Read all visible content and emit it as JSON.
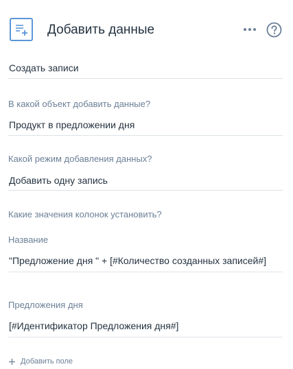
{
  "header": {
    "title": "Добавить данные",
    "icon": "add-data-icon",
    "accent_color": "#5b95d8",
    "more_icon": "more-dots-icon",
    "help_icon": "help-circle-icon"
  },
  "operation": {
    "value": "Создать записи"
  },
  "object": {
    "label": "В какой объект добавить данные?",
    "value": "Продукт в предложении дня"
  },
  "mode": {
    "label": "Какой режим добавления данных?",
    "value": "Добавить одну запись"
  },
  "columns": {
    "title": "Какие значения колонок установить?",
    "items": [
      {
        "label": "Название",
        "value": "\"Предложение дня \" + [#Количество созданных записей#]"
      },
      {
        "label": "Предложения дня",
        "value": "[#Идентификатор Предложения дня#]"
      }
    ]
  },
  "add_field": {
    "label": "Добавить поле",
    "icon": "plus-icon"
  }
}
